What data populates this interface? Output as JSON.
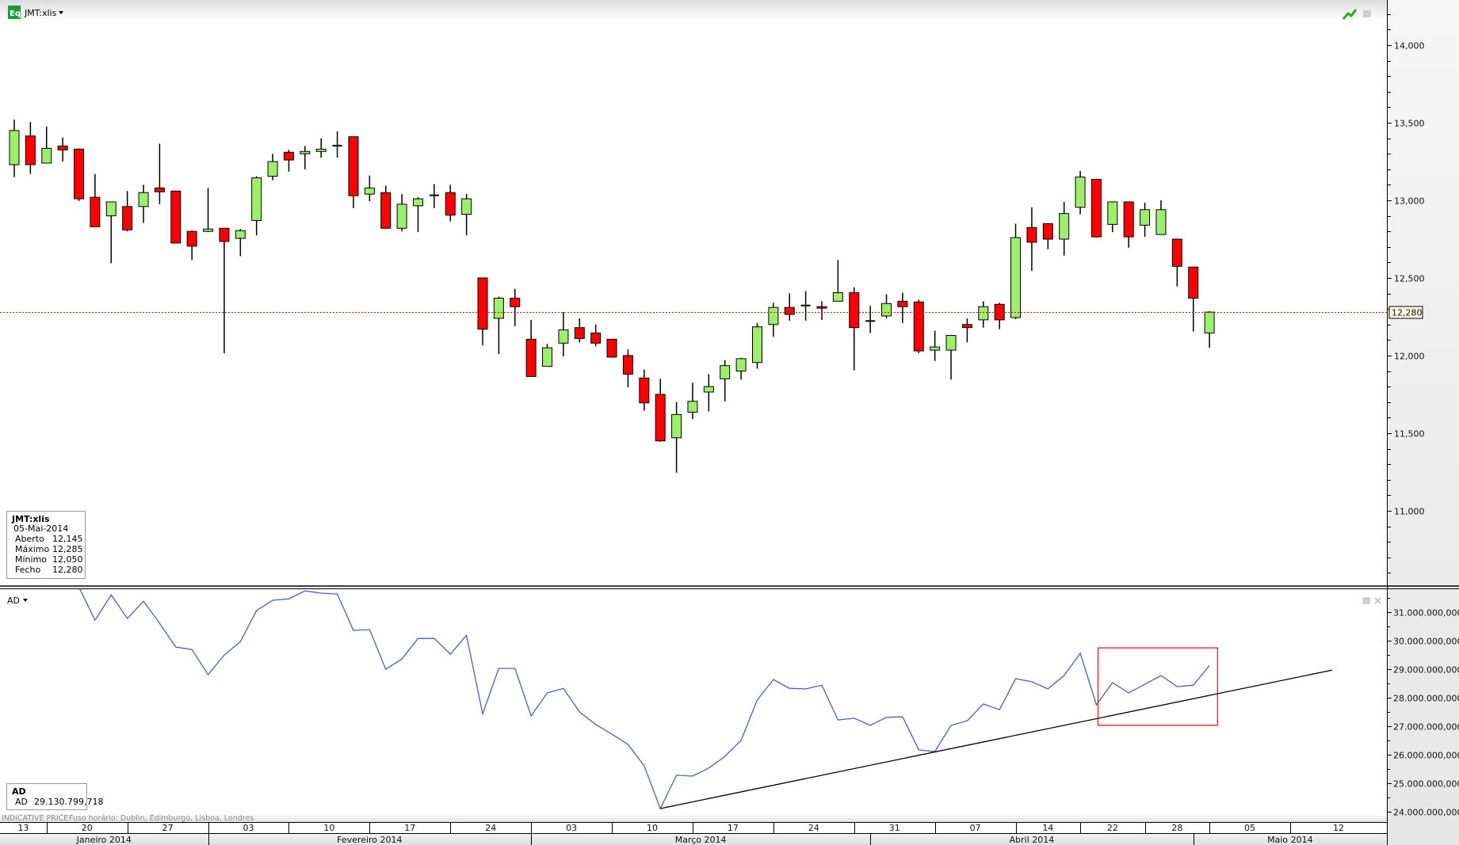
{
  "header": {
    "app_icon_label": "Eq",
    "symbol": "JMT:xlis"
  },
  "colors": {
    "up": "#9cee6c",
    "down": "#ff0000",
    "ad_line": "#4a5fc1",
    "last_price_line": "#ff0000",
    "annotation_box": "#ff0000",
    "trendline": "#000000"
  },
  "icons": {
    "chart_type": "green-line-chart-icon",
    "restore": "restore-window-icon",
    "close": "close-icon",
    "dropdown": "caret-down-icon"
  },
  "info_box": {
    "title": "JMT:xlis",
    "date": "05-Mai-2014",
    "rows": [
      {
        "label": "Aberto",
        "value": "12,145"
      },
      {
        "label": "Máximo",
        "value": "12,285"
      },
      {
        "label": "Mínimo",
        "value": "12,050"
      },
      {
        "label": "Fecho",
        "value": "12,280"
      }
    ]
  },
  "ad_panel": {
    "title": "AD",
    "box_title": "AD",
    "box_label": "AD",
    "box_value": "29.130.799,718"
  },
  "status": {
    "price_type": "INDICATIVE PRICE",
    "timezone": "Fuso horário: Dublin, Edimburgo, Lisboa, Londres"
  },
  "last_price_label": "12,280",
  "time_axis": {
    "weeks": [
      "13",
      "20",
      "27",
      "03",
      "10",
      "17",
      "24",
      "03",
      "10",
      "17",
      "24",
      "31",
      "07",
      "14",
      "22",
      "28",
      "05",
      "12"
    ],
    "week_start_bars": [
      -2,
      2,
      7,
      12,
      17,
      22,
      27,
      32,
      37,
      42,
      47,
      52,
      57,
      62,
      66,
      70,
      74,
      79
    ],
    "months": [
      "Janeiro 2014",
      "Fevereiro 2014",
      "Março 2014",
      "Abril 2014",
      "Maio 2014"
    ],
    "month_start_bars": [
      -3,
      12,
      32,
      53,
      73,
      93
    ]
  },
  "chart_data": [
    {
      "type": "candlestick",
      "title": "JMT:xlis",
      "ylim": [
        10525,
        14291
      ],
      "yticks": [
        11000,
        11500,
        12000,
        12500,
        13000,
        13500,
        14000
      ],
      "ytick_labels": [
        "11,000",
        "11,500",
        "12,000",
        "12,500",
        "13,000",
        "13,500",
        "14,000"
      ],
      "minor_tick_step": 100,
      "last_price": 12280,
      "first_date": "16-Jan-2014",
      "last_date": "05-Mai-2014",
      "ohlc": [
        [
          13230,
          13520,
          13150,
          13450
        ],
        [
          13415,
          13505,
          13170,
          13230
        ],
        [
          13240,
          13475,
          13240,
          13335
        ],
        [
          13350,
          13405,
          13250,
          13325
        ],
        [
          13330,
          13335,
          12995,
          13010
        ],
        [
          13020,
          13170,
          12830,
          12830
        ],
        [
          12900,
          12990,
          12595,
          12990
        ],
        [
          12960,
          13060,
          12800,
          12810
        ],
        [
          12960,
          13100,
          12855,
          13050
        ],
        [
          13080,
          13365,
          12975,
          13055
        ],
        [
          13060,
          13060,
          12725,
          12725
        ],
        [
          12800,
          12805,
          12615,
          12705
        ],
        [
          12800,
          13080,
          12795,
          12815
        ],
        [
          12820,
          12820,
          12015,
          12735
        ],
        [
          12755,
          12815,
          12640,
          12805
        ],
        [
          12870,
          13155,
          12775,
          13145
        ],
        [
          13155,
          13300,
          13130,
          13250
        ],
        [
          13310,
          13325,
          13185,
          13260
        ],
        [
          13300,
          13350,
          13200,
          13315
        ],
        [
          13315,
          13400,
          13275,
          13330
        ],
        [
          13350,
          13445,
          13275,
          13355
        ],
        [
          13410,
          13410,
          12950,
          13030
        ],
        [
          13040,
          13160,
          12995,
          13080
        ],
        [
          13050,
          13095,
          12820,
          12820
        ],
        [
          12820,
          13040,
          12800,
          12975
        ],
        [
          12965,
          13020,
          12795,
          13010
        ],
        [
          13030,
          13105,
          12950,
          13035
        ],
        [
          13050,
          13100,
          12865,
          12905
        ],
        [
          12910,
          13040,
          12775,
          13010
        ],
        [
          12500,
          12500,
          12065,
          12170
        ],
        [
          12240,
          12380,
          12010,
          12370
        ],
        [
          12370,
          12430,
          12190,
          12315
        ],
        [
          12105,
          12230,
          11865,
          11865
        ],
        [
          11930,
          12075,
          11930,
          12050
        ],
        [
          12080,
          12280,
          11995,
          12165
        ],
        [
          12180,
          12240,
          12085,
          12110
        ],
        [
          12145,
          12200,
          12060,
          12080
        ],
        [
          12105,
          12105,
          11990,
          11990
        ],
        [
          12000,
          12040,
          11795,
          11880
        ],
        [
          11855,
          11910,
          11645,
          11695
        ],
        [
          11750,
          11850,
          11445,
          11450
        ],
        [
          11470,
          11700,
          11245,
          11620
        ],
        [
          11635,
          11825,
          11590,
          11705
        ],
        [
          11765,
          11880,
          11640,
          11800
        ],
        [
          11850,
          11970,
          11705,
          11935
        ],
        [
          11900,
          11985,
          11845,
          11980
        ],
        [
          11955,
          12210,
          11915,
          12185
        ],
        [
          12200,
          12340,
          12120,
          12310
        ],
        [
          12310,
          12400,
          12225,
          12265
        ],
        [
          12320,
          12415,
          12225,
          12325
        ],
        [
          12315,
          12350,
          12230,
          12305
        ],
        [
          12350,
          12615,
          12350,
          12405
        ],
        [
          12405,
          12440,
          11905,
          12180
        ],
        [
          12220,
          12320,
          12145,
          12225
        ],
        [
          12255,
          12395,
          12240,
          12335
        ],
        [
          12350,
          12405,
          12210,
          12315
        ],
        [
          12345,
          12360,
          12015,
          12030
        ],
        [
          12035,
          12160,
          11965,
          12055
        ],
        [
          12035,
          12130,
          11845,
          12130
        ],
        [
          12200,
          12240,
          12085,
          12180
        ],
        [
          12230,
          12350,
          12180,
          12315
        ],
        [
          12330,
          12340,
          12170,
          12230
        ],
        [
          12245,
          12850,
          12235,
          12760
        ],
        [
          12825,
          12955,
          12545,
          12730
        ],
        [
          12850,
          12850,
          12685,
          12750
        ],
        [
          12750,
          12990,
          12645,
          12915
        ],
        [
          12955,
          13190,
          12910,
          13150
        ],
        [
          13135,
          13140,
          12760,
          12765
        ],
        [
          12845,
          12990,
          12795,
          12990
        ],
        [
          12990,
          12990,
          12695,
          12765
        ],
        [
          12840,
          12985,
          12765,
          12940
        ],
        [
          12780,
          13000,
          12780,
          12940
        ],
        [
          12750,
          12750,
          12445,
          12575
        ],
        [
          12570,
          12570,
          12155,
          12370
        ],
        [
          12145,
          12285,
          12050,
          12280
        ]
      ]
    },
    {
      "type": "line",
      "title": "AD",
      "unit": "billions",
      "ylim": [
        23.72,
        31.92
      ],
      "yticks": [
        24,
        25,
        26,
        27,
        28,
        29,
        30,
        31
      ],
      "ytick_labels": [
        "24.000.000,000",
        "25.000.000,000",
        "26.000.000,000",
        "27.000.000,000",
        "28.000.000,000",
        "29.000.000,000",
        "30.000.000,000",
        "31.000.000,000"
      ],
      "first_bar": 4,
      "values": [
        31.89,
        30.72,
        31.61,
        30.78,
        31.39,
        30.61,
        29.78,
        29.69,
        28.81,
        29.5,
        29.97,
        31.06,
        31.42,
        31.47,
        31.75,
        31.67,
        31.64,
        30.36,
        30.39,
        29.0,
        29.36,
        30.08,
        30.08,
        29.53,
        30.19,
        27.44,
        29.03,
        29.03,
        27.36,
        28.17,
        28.33,
        27.5,
        27.06,
        26.72,
        26.36,
        25.61,
        24.11,
        25.28,
        25.25,
        25.53,
        25.94,
        26.5,
        27.92,
        28.64,
        28.33,
        28.31,
        28.44,
        27.22,
        27.28,
        27.03,
        27.31,
        27.33,
        26.17,
        26.11,
        27.03,
        27.19,
        27.78,
        27.58,
        28.67,
        28.56,
        28.31,
        28.78,
        29.56,
        27.75,
        28.53,
        28.17,
        28.47,
        28.78,
        28.39,
        28.44,
        29.13
      ],
      "trendline": {
        "start_bar": 40,
        "start_value": 24.11,
        "end_bar": 81.6,
        "end_value": 28.97
      },
      "annotation_box": {
        "bar_from": 67.1,
        "bar_to": 74.5,
        "value_from": 27.03,
        "value_to": 29.75
      }
    }
  ]
}
